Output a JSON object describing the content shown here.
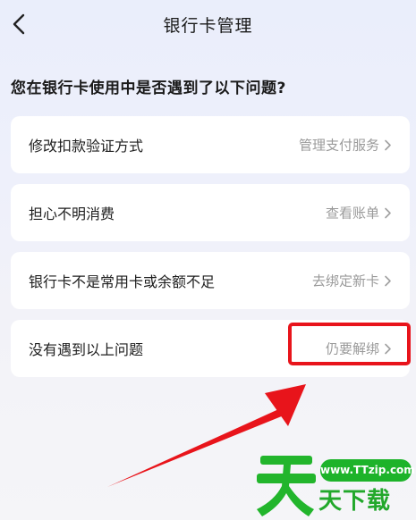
{
  "nav": {
    "title": "银行卡管理"
  },
  "question": "您在银行卡使用中是否遇到了以下问题?",
  "options": [
    {
      "label": "修改扣款验证方式",
      "action": "管理支付服务"
    },
    {
      "label": "担心不明消费",
      "action": "查看账单"
    },
    {
      "label": "银行卡不是常用卡或余额不足",
      "action": "去绑定新卡"
    },
    {
      "label": "没有遇到以上问题",
      "action": "仍要解绑"
    }
  ],
  "watermark": {
    "url": "www.TTzip.com",
    "text": "天下载"
  },
  "colors": {
    "highlight": "#e8141b",
    "arrow": "#e8141b",
    "watermark_green": "#1db32a"
  },
  "icons": {
    "back": "chevron-left-icon",
    "row_chevron": "chevron-right-icon"
  }
}
